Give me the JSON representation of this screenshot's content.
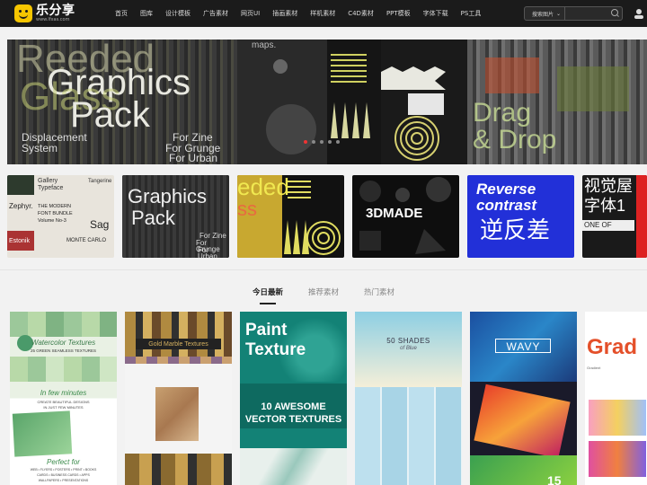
{
  "logo": {
    "name": "乐分享",
    "url": "www.lfxas.com"
  },
  "nav": [
    "首页",
    "图库",
    "设计模板",
    "广告素材",
    "网页UI",
    "插画素材",
    "样机素材",
    "C4D素材",
    "PPT模板",
    "字体下载",
    "PS工具"
  ],
  "search": {
    "category": "搜索图片",
    "placeholder": ""
  },
  "banner": {
    "line1": "Reeded",
    "line2": "Graphics",
    "line3": "Glass",
    "line4": "Pack",
    "sub1": "Displacement",
    "sub2": "System",
    "zine1": "For Zine",
    "zine2": "For Grunge",
    "zine3": "For Urban",
    "maps": "maps.",
    "drag": "Drag",
    "drop": "& Drop",
    "slides": 5
  },
  "thumbs": [
    {
      "a": "Gallery",
      "b": "Typeface",
      "c": "Zephyr.",
      "d": "THE MODERN",
      "e": "FONT BUNDLE",
      "f": "Volume No-3",
      "g": "Sag",
      "h": "Tangerine",
      "i": "Estonik",
      "j": "MONTE CARLO"
    },
    {
      "a": "Graphics",
      "b": "Pack",
      "c": "For Zine",
      "d": "For Grunge",
      "e": "For Urban"
    },
    {
      "a": "eded",
      "b": "ss"
    },
    {
      "a": "3DMADE"
    },
    {
      "a": "Reverse",
      "b": "contrast",
      "c": "逆反差"
    },
    {
      "a": "视觉屋",
      "b": "字体1",
      "c": "ONE OF"
    }
  ],
  "tabs": [
    "今日最新",
    "推荐素材",
    "热门素材"
  ],
  "cards": [
    {
      "a": "Watercolor Textures",
      "b": "25 GREEN SEAMLESS TEXTURES",
      "c": "In few minutes",
      "d": "CREATE BEAUTIFUL DESIGNS",
      "e": "IN JUST FEW MINUTES",
      "f": "Perfect for",
      "g": "WEB • FLYERS • POSTERS • PRINT • BOOKS",
      "h": "CARDS • BUSINESS CARDS • APPS",
      "i": "WALLPAPERS • PRESENTATIONS"
    },
    {
      "a": "Gold Marble Textures"
    },
    {
      "a": "Paint",
      "b": "Texture",
      "c": "10 AWESOME",
      "d": "VECTOR TEXTURES"
    },
    {
      "a": "50 SHADES",
      "b": "of Blue"
    },
    {
      "a": "WAVY",
      "b": "15"
    },
    {
      "a": "Grad",
      "b": "Gradient"
    }
  ]
}
